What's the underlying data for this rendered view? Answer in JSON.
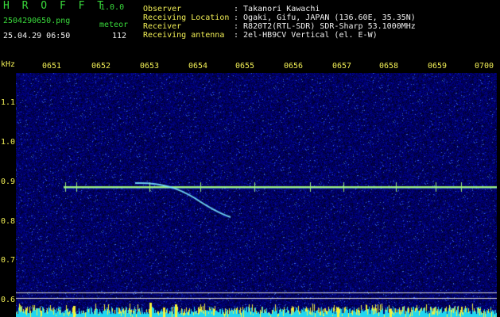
{
  "header": {
    "app_title": "H R O F F T",
    "version": "1.0.0",
    "filename": "2504290650.png",
    "datetime": "25.04.29 06:50",
    "meteor_label": "meteor",
    "meteor_count": "112",
    "observer_label": "Observer",
    "observer_value": ": Takanori Kawachi",
    "location_label": "Receiving Location",
    "location_value": ": Ogaki, Gifu, JAPAN (136.60E, 35.35N)",
    "receiver_label": "Receiver",
    "receiver_value": ": R820T2(RTL-SDR) SDR-Sharp 53.1000MHz",
    "antenna_label": "Receiving antenna",
    "antenna_value": ": 2el-HB9CV Vertical (el. E-W)"
  },
  "axes": {
    "unit": "kHz",
    "time_ticks": [
      "0651",
      "0652",
      "0653",
      "0654",
      "0655",
      "0656",
      "0657",
      "0658",
      "0659",
      "0700"
    ],
    "freq_ticks": [
      "1.1",
      "1.0",
      "0.9",
      "0.8",
      "0.7",
      "0.6"
    ]
  },
  "colors": {
    "background": "#000000",
    "noise_base": "#0a0a80",
    "carrier": "#9ef07a",
    "header_green": "#39d93b",
    "header_yellow": "#f1ee55"
  }
}
